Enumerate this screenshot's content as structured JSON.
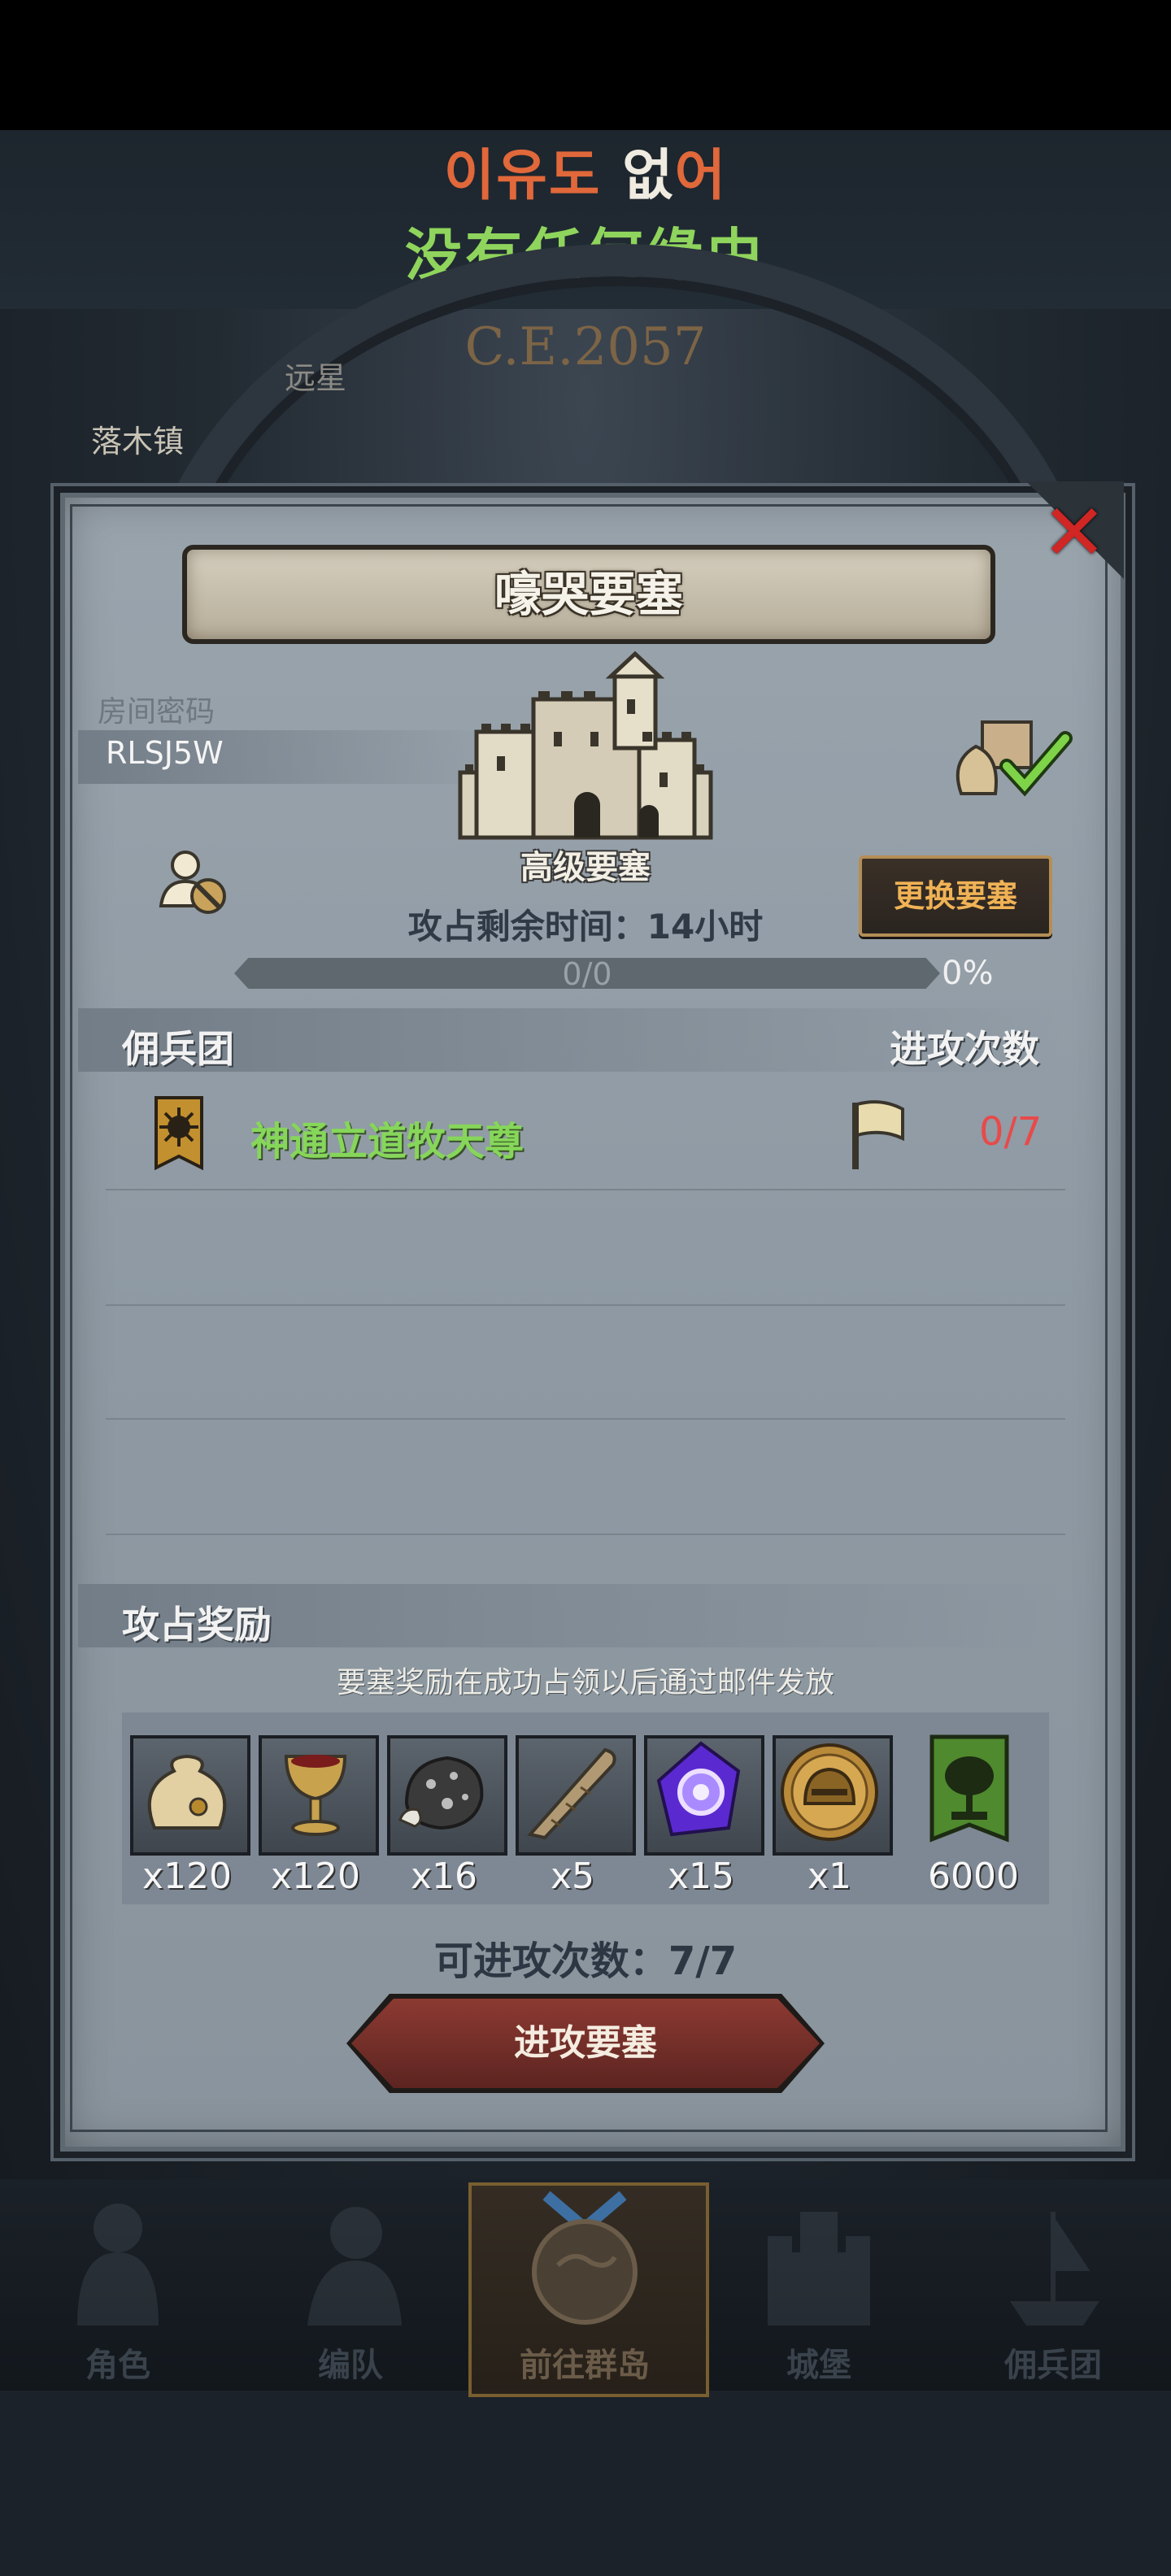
{
  "subtitle": {
    "korean_part1": "이유도 ",
    "korean_highlight": "없",
    "korean_part2": "어",
    "chinese": "没有任何缘由"
  },
  "background": {
    "year": "C.E.2057",
    "town": "落木镇",
    "expedition": "远星"
  },
  "modal": {
    "title": "嚎哭要塞",
    "room_code_label": "房间密码",
    "room_code_value": "RLSJ5W",
    "fortress_grade": "高级要塞",
    "change_fortress_button": "更换要塞",
    "time_remaining": "攻占剩余时间：14小时",
    "progress": {
      "text": "0/0",
      "percent_label": "0%",
      "fraction": 0
    },
    "mercenary_section": {
      "title": "佣兵团",
      "attack_count_title": "进攻次数",
      "entries": [
        {
          "name": "神通立道牧天尊",
          "count": "0/7"
        }
      ]
    },
    "reward_section": {
      "title": "攻占奖励",
      "note": "要塞奖励在成功占领以后通过邮件发放",
      "items": [
        {
          "icon": "coin-bag-icon",
          "qty": "x120"
        },
        {
          "icon": "goblet-icon",
          "qty": "x120"
        },
        {
          "icon": "ore-icon",
          "qty": "x16"
        },
        {
          "icon": "horn-icon",
          "qty": "x5"
        },
        {
          "icon": "purple-crystal-icon",
          "qty": "x15"
        },
        {
          "icon": "helmet-medal-icon",
          "qty": "x1"
        },
        {
          "icon": "tree-banner-icon",
          "qty": "6000"
        }
      ]
    },
    "attempts": "可进攻次数：7/7",
    "attack_button": "进攻要塞"
  },
  "bottom_nav": {
    "tabs": [
      {
        "label": "角色",
        "active": false
      },
      {
        "label": "编队",
        "active": false
      },
      {
        "label": "前往群岛",
        "active": true
      },
      {
        "label": "城堡",
        "active": false
      },
      {
        "label": "佣兵团",
        "active": false
      }
    ]
  },
  "colors": {
    "accent_green": "#86d65a",
    "accent_orange": "#f0b255",
    "count_red": "#e84a4a",
    "close_red": "#d02624"
  }
}
